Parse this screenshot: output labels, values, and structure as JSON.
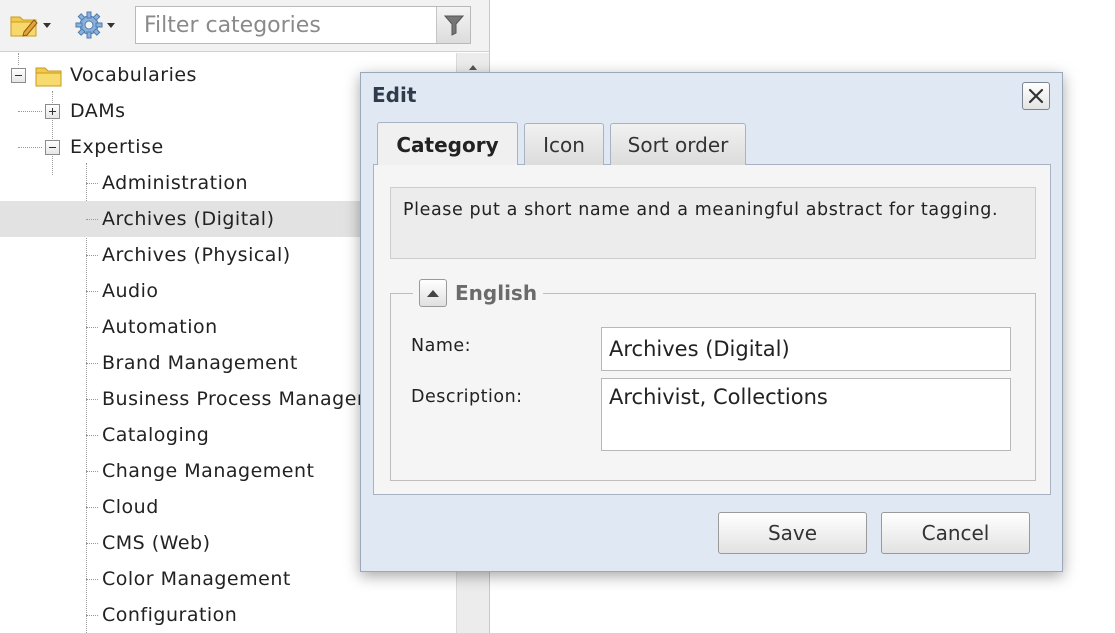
{
  "toolbar": {
    "folder_icon": "folder-edit-icon",
    "settings_icon": "gear-icon",
    "filter_placeholder": "Filter categories",
    "filter_value": "",
    "filter_icon": "funnel-icon"
  },
  "tree": {
    "root": {
      "label": "Vocabularies",
      "icon": "folder-icon",
      "expanded": true
    },
    "groups": [
      {
        "label": "DAMs",
        "expanded": false
      },
      {
        "label": "Expertise",
        "expanded": true
      }
    ],
    "items": [
      {
        "label": "Administration"
      },
      {
        "label": "Archives (Digital)",
        "selected": true
      },
      {
        "label": "Archives (Physical)"
      },
      {
        "label": "Audio"
      },
      {
        "label": "Automation"
      },
      {
        "label": "Brand Management"
      },
      {
        "label": "Business Process Management"
      },
      {
        "label": "Cataloging"
      },
      {
        "label": "Change Management"
      },
      {
        "label": "Cloud"
      },
      {
        "label": "CMS (Web)"
      },
      {
        "label": "Color Management"
      },
      {
        "label": "Configuration"
      }
    ]
  },
  "dialog": {
    "title": "Edit",
    "close_icon": "close-icon",
    "tabs": [
      {
        "label": "Category",
        "active": true
      },
      {
        "label": "Icon",
        "active": false
      },
      {
        "label": "Sort order",
        "active": false
      }
    ],
    "hint": "Please put a short name and a meaningful abstract for tagging.",
    "fieldset_legend": "English",
    "collapse_icon": "chevron-up-icon",
    "name_label": "Name:",
    "name_value": "Archives (Digital)",
    "description_label": "Description:",
    "description_value": "Archivist, Collections",
    "save_label": "Save",
    "cancel_label": "Cancel"
  },
  "colors": {
    "dialog_background": "#dfe8f3",
    "selection": "#e2e2e2",
    "folder": "#f2c94c"
  }
}
